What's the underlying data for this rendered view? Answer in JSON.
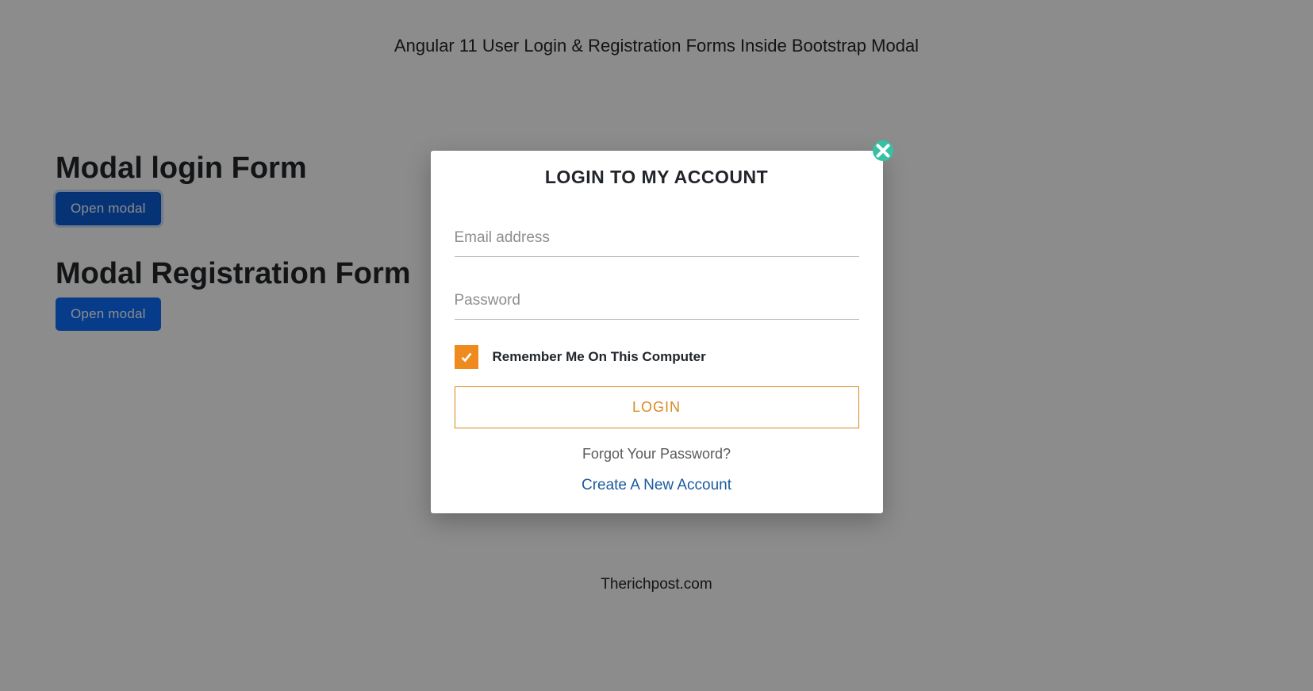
{
  "header": {
    "title": "Angular 11 User Login & Registration Forms Inside Bootstrap Modal"
  },
  "sections": {
    "login": {
      "heading": "Modal login Form",
      "button_label": "Open modal"
    },
    "registration": {
      "heading": "Modal Registration Form",
      "button_label": "Open modal"
    }
  },
  "footer": {
    "text": "Therichpost.com"
  },
  "modal": {
    "title": "LOGIN TO MY ACCOUNT",
    "email": {
      "placeholder": "Email address",
      "value": ""
    },
    "password": {
      "placeholder": "Password",
      "value": ""
    },
    "remember": {
      "label": "Remember Me On This Computer",
      "checked": true
    },
    "login_button": "LOGIN",
    "forgot_link": "Forgot Your Password?",
    "create_link": "Create A New Account"
  },
  "colors": {
    "primary_button": "#0d6efd",
    "checkbox": "#ef8a1f",
    "login_border": "#d88a1f",
    "close_btn": "#34c2a4",
    "link": "#1a5a9e"
  }
}
